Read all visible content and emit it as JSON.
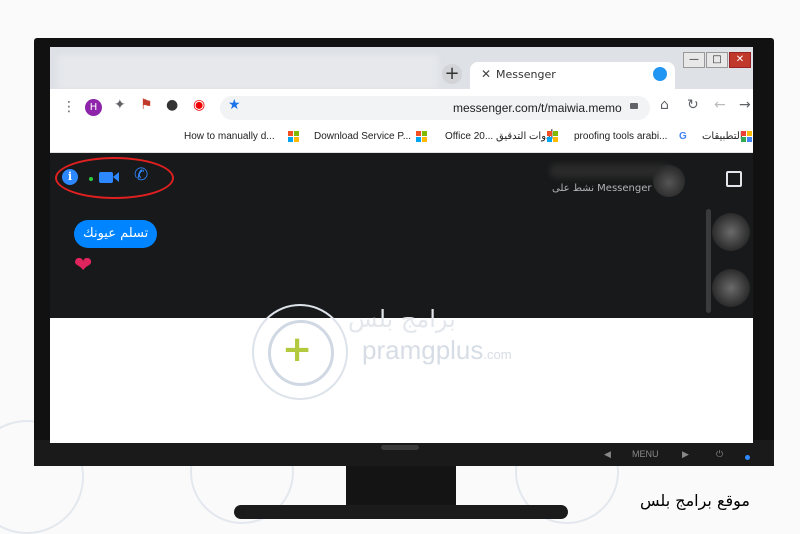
{
  "browser": {
    "active_tab": {
      "title": "Messenger"
    },
    "new_tab_symbol": "+",
    "tab_close_symbol": "✕",
    "window_controls": {
      "minimize": "—",
      "maximize": "□",
      "close": "✕"
    },
    "url": "messenger.com/t/maiwia.memo",
    "profile_initial": "H",
    "bookmarks": [
      "How to manually d...",
      "Download Service P...",
      "Office 20...",
      "أدوات التدقيق",
      "proofing tools arabi...",
      "التطبيقات"
    ]
  },
  "messenger": {
    "contact_status": "نشط على Messenger",
    "message_text": "تسلم عيونك",
    "reaction_emoji": "❤",
    "header_icons": [
      "info-icon",
      "video-call-icon",
      "phone-call-icon"
    ]
  },
  "monitor": {
    "menu_label": "MENU",
    "power_symbol": "⏻"
  },
  "watermark": {
    "brand_text": "pramgplus",
    "brand_suffix": ".com",
    "arabic_text": "برامج بلس"
  },
  "caption": "موقع برامج بلس",
  "colors": {
    "messenger_blue": "#0084ff",
    "dark_background": "#18191a",
    "highlight_red": "#e02020",
    "brand_green": "#b3c93e"
  }
}
